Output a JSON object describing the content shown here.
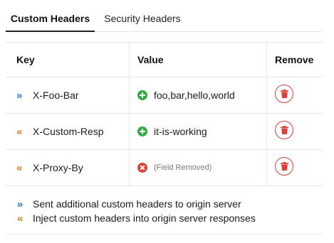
{
  "tabs": [
    {
      "label": "Custom Headers",
      "active": true
    },
    {
      "label": "Security Headers",
      "active": false
    }
  ],
  "table": {
    "headers": {
      "key": "Key",
      "value": "Value",
      "remove": "Remove"
    },
    "rows": [
      {
        "direction": "outbound",
        "direction_icon": "»",
        "key": "X-Foo-Bar",
        "status": "added",
        "value": "foo,bar,hello,world"
      },
      {
        "direction": "inbound",
        "direction_icon": "«",
        "key": "X-Custom-Resp",
        "status": "added",
        "value": "it-is-working"
      },
      {
        "direction": "inbound",
        "direction_icon": "«",
        "key": "X-Proxy-By",
        "status": "removed",
        "value": "(Field Removed)"
      }
    ]
  },
  "legend": {
    "outbound_icon": "»",
    "outbound_text": "Sent additional custom headers to origin server",
    "inbound_icon": "«",
    "inbound_text": "Inject custom headers into origin server responses"
  },
  "colors": {
    "outbound": "#2a7ad0",
    "inbound": "#e07b2a",
    "added": "#2fae3d",
    "removed": "#d9423b",
    "remove_button": "#d9423b"
  }
}
